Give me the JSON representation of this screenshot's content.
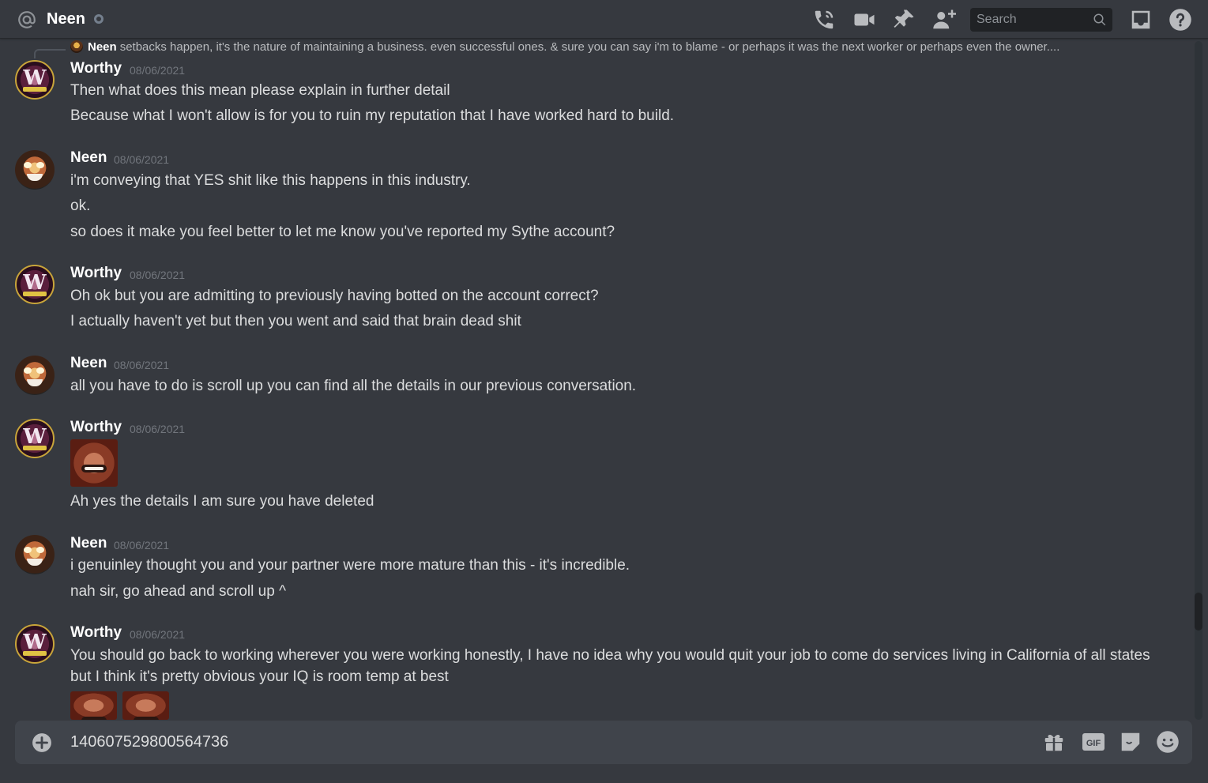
{
  "header": {
    "title": "Neen",
    "search_placeholder": "Search"
  },
  "reply_preview": {
    "name": "Neen",
    "text": "setbacks happen, it's the nature of maintaining a business. even successful ones. & sure you can say i'm to blame - or perhaps it was the next worker or perhaps even  the owner...."
  },
  "messages": [
    {
      "author": "Worthy",
      "timestamp": "08/06/2021",
      "lines": [
        "Then what does this mean please explain in further detail",
        "Because what I won't allow is for you to ruin my reputation that I have worked hard to build."
      ]
    },
    {
      "author": "Neen",
      "timestamp": "08/06/2021",
      "lines": [
        "i'm conveying that YES shit like this happens in this industry.",
        "ok.",
        "so does it make you feel better to let me know you've reported my Sythe account?"
      ]
    },
    {
      "author": "Worthy",
      "timestamp": "08/06/2021",
      "lines": [
        "Oh ok but you are admitting to previously having botted on the account correct?",
        "I actually haven't yet but then you went and said that brain dead shit"
      ]
    },
    {
      "author": "Neen",
      "timestamp": "08/06/2021",
      "lines": [
        "all you have to do is scroll up you can find all the details in our previous conversation."
      ]
    },
    {
      "author": "Worthy",
      "timestamp": "08/06/2021",
      "lines": [
        "Ah yes the details I am sure you have deleted"
      ]
    },
    {
      "author": "Neen",
      "timestamp": "08/06/2021",
      "lines": [
        "i genuinley thought you and your partner were more mature than this - it's incredible.",
        "nah sir, go ahead and scroll up ^"
      ]
    },
    {
      "author": "Worthy",
      "timestamp": "08/06/2021",
      "lines": [
        "You should go back to working wherever you were working honestly, I have no idea why you would quit your job to come do services living in California of all states",
        "but I think it's pretty obvious your IQ is room temp at best"
      ]
    }
  ],
  "composer": {
    "value": "140607529800564736"
  },
  "icons": {
    "header": [
      "at-icon",
      "call-icon",
      "video-icon",
      "pin-icon",
      "add-friend-icon",
      "search-icon",
      "inbox-icon",
      "help-icon"
    ],
    "composer": [
      "plus-icon",
      "gift-icon",
      "gif-icon",
      "sticker-icon",
      "emoji-icon"
    ]
  },
  "colors": {
    "background": "#36393f",
    "composer": "#40444b",
    "search": "#202225",
    "username": "#ffffff",
    "timestamp": "#72767d",
    "text": "#dcddde"
  }
}
